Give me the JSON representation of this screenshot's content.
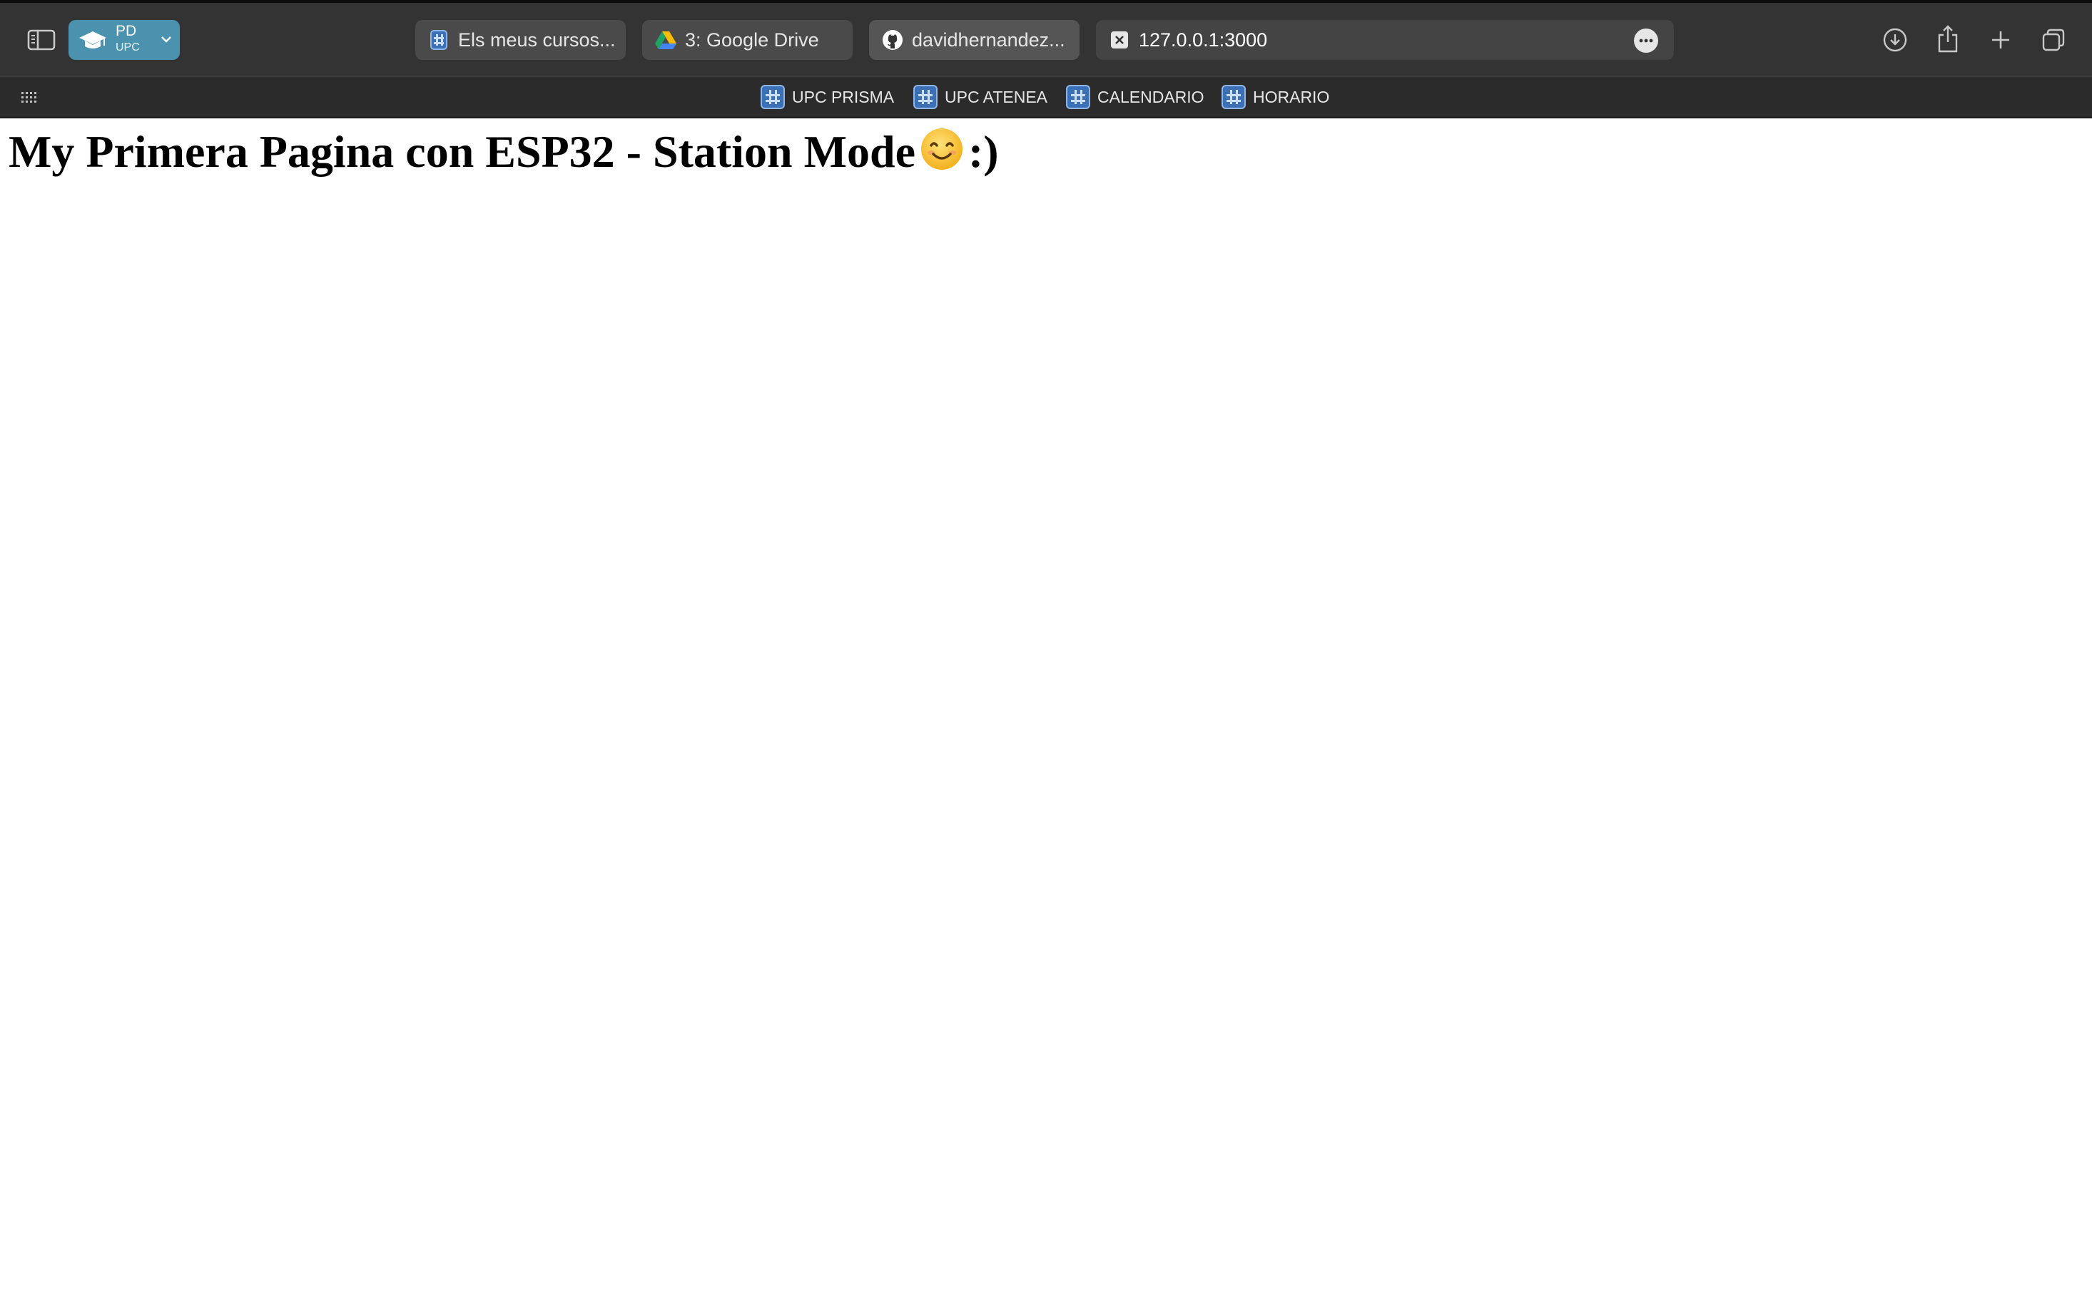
{
  "profile": {
    "name": "PD",
    "subtitle": "UPC"
  },
  "tabs": [
    {
      "label": "Els meus cursos...",
      "favicon": "grid-icon"
    },
    {
      "label": "3: Google Drive",
      "favicon": "google-drive-icon"
    },
    {
      "label": "davidhernandez...",
      "favicon": "github-icon"
    },
    {
      "label": "127.0.0.1:3000",
      "favicon": "close-icon",
      "active": true
    }
  ],
  "bookmarks": [
    {
      "label": "UPC PRISMA",
      "icon": "grid-icon"
    },
    {
      "label": "UPC ATENEA",
      "icon": "grid-icon"
    },
    {
      "label": "CALENDARIO",
      "icon": "grid-icon"
    },
    {
      "label": "HORARIO",
      "icon": "grid-icon"
    }
  ],
  "page": {
    "heading_text": "My Primera Pagina con ESP32 - Station Mode",
    "heading_emoji": "smiling-face-icon",
    "heading_suffix": ":)"
  },
  "colors": {
    "toolbar_bg": "#333333",
    "profile_accent": "#4a92ad",
    "page_bg": "#ffffff"
  }
}
